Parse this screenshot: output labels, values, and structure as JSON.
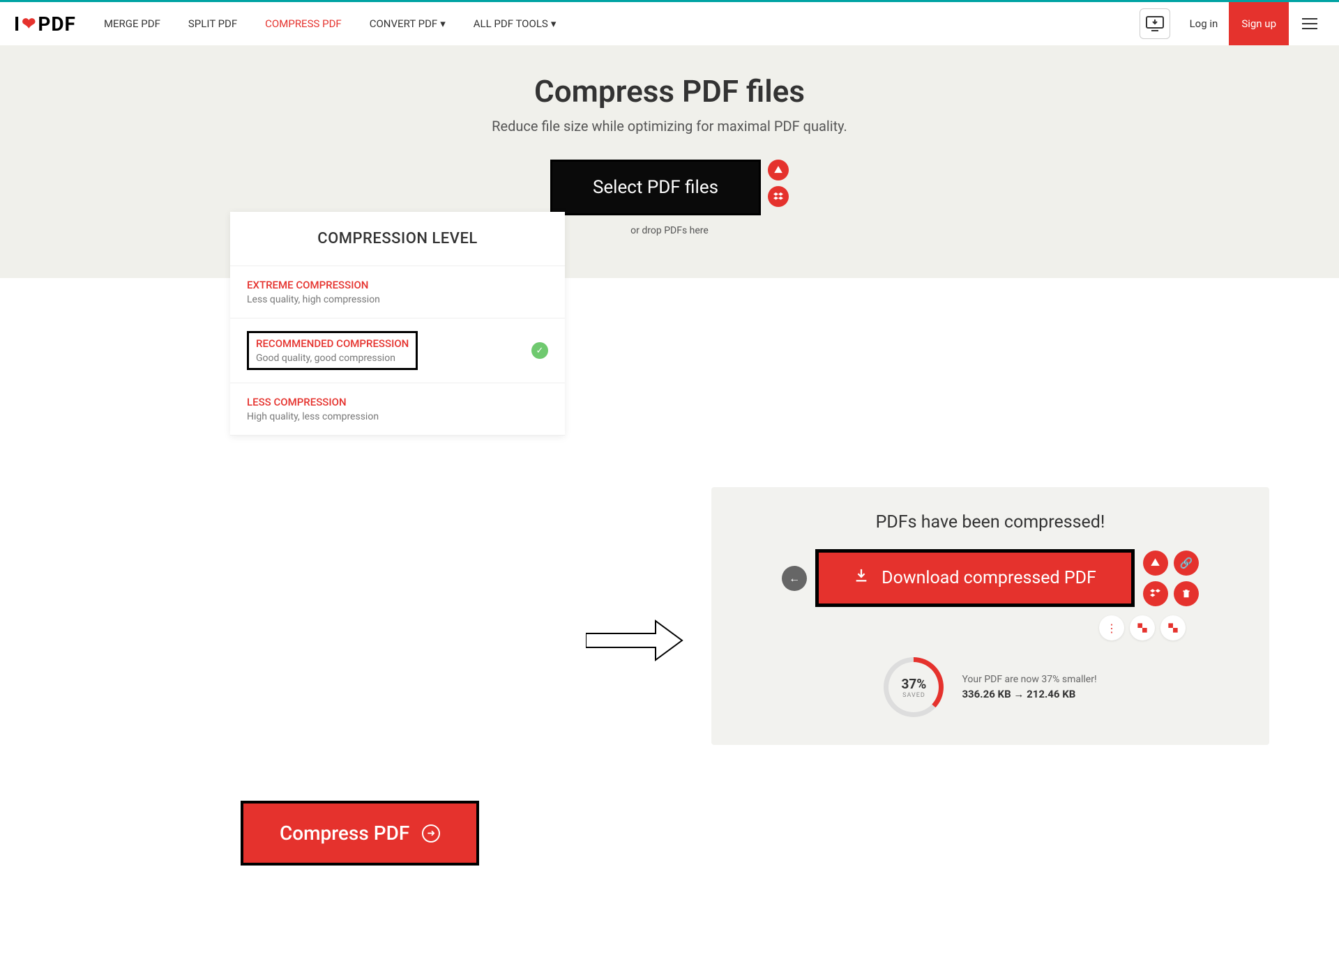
{
  "header": {
    "logo_i": "I",
    "logo_pdf": "PDF",
    "nav": {
      "merge": "MERGE PDF",
      "split": "SPLIT PDF",
      "compress": "COMPRESS PDF",
      "convert": "CONVERT PDF",
      "all": "ALL PDF TOOLS"
    },
    "login": "Log in",
    "signup": "Sign up"
  },
  "hero": {
    "title": "Compress PDF files",
    "subtitle": "Reduce file size while optimizing for maximal PDF quality.",
    "select_button": "Select PDF files",
    "drop_hint": "or drop PDFs here"
  },
  "panel": {
    "title": "COMPRESSION LEVEL",
    "levels": [
      {
        "name": "EXTREME COMPRESSION",
        "desc": "Less quality, high compression"
      },
      {
        "name": "RECOMMENDED COMPRESSION",
        "desc": "Good quality, good compression"
      },
      {
        "name": "LESS COMPRESSION",
        "desc": "High quality, less compression"
      }
    ]
  },
  "compress_btn": "Compress PDF",
  "result": {
    "title": "PDFs have been compressed!",
    "download": "Download compressed PDF",
    "percent": "37%",
    "saved_label": "SAVED",
    "smaller_text": "Your PDF are now 37% smaller!",
    "size_before": "336.26 KB",
    "size_arrow": "→",
    "size_after": "212.46 KB"
  }
}
